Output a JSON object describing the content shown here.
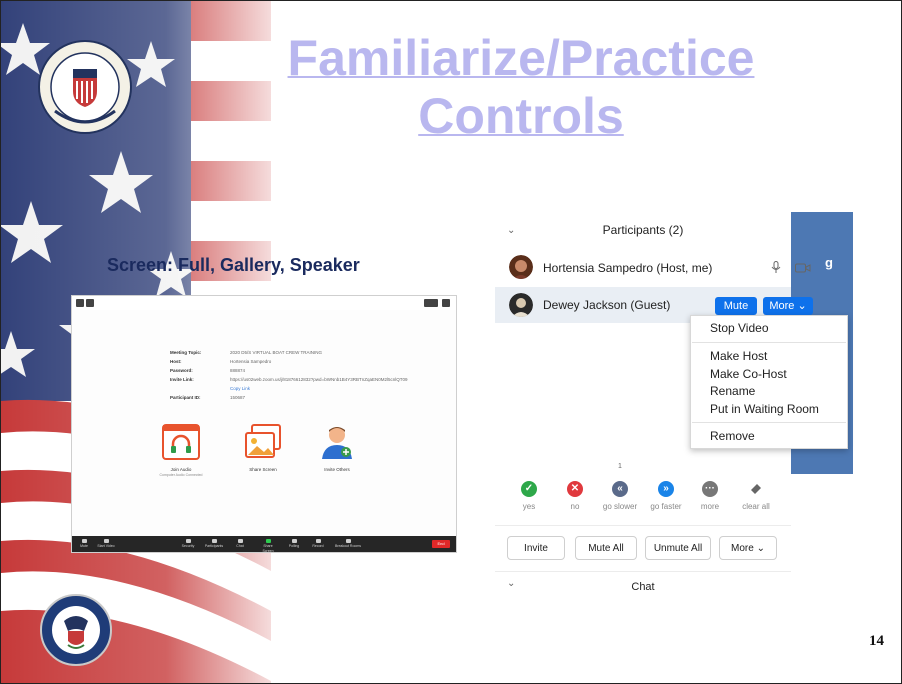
{
  "slide": {
    "title_line1": "Familiarize/Practice",
    "title_line2": "Controls",
    "caption": "Screen: Full, Gallery, Speaker",
    "page_number": "14"
  },
  "zoom_screen": {
    "info_rows": [
      {
        "key": "Meeting Topic:",
        "value": "2020 D5/S VIRTUAL BOAT CREW TRAINING"
      },
      {
        "key": "Host:",
        "value": "Hortensia Sampedro"
      },
      {
        "key": "Password:",
        "value": "888874"
      },
      {
        "key": "Invite Link:",
        "value": "https://us02web.zoom.us/j/81876612832?pwd=bWNnb1B4Y3RBTnZqaEN0M2l5cnlQT09"
      },
      {
        "key": "Participant ID:",
        "value": "150687"
      }
    ],
    "copy_link": "Copy Link",
    "tiles": {
      "join_audio": "Join Audio",
      "join_audio_sub": "Computer Audio Connected",
      "share_screen": "Share Screen",
      "invite_others": "Invite Others"
    },
    "controls": [
      "Mute",
      "Start Video",
      "Security",
      "Participants",
      "Chat",
      "Share Screen",
      "Polling",
      "Record",
      "Breakout Rooms"
    ],
    "end_label": "End"
  },
  "participants": {
    "header": "Participants (2)",
    "host_name": "Hortensia Sampedro (Host, me)",
    "guest_name": "Dewey Jackson (Guest)",
    "mute_label": "Mute",
    "more_label": "More",
    "strip_letter": "g",
    "menu": {
      "stop_video": "Stop Video",
      "make_host": "Make Host",
      "make_cohost": "Make Co-Host",
      "rename": "Rename",
      "waiting_room": "Put in Waiting Room",
      "remove": "Remove"
    },
    "reaction_count": "1",
    "reactions": {
      "yes": "yes",
      "no": "no",
      "slower": "go slower",
      "faster": "go faster",
      "more": "more",
      "clear": "clear all"
    },
    "actions": {
      "invite": "Invite",
      "mute_all": "Mute All",
      "unmute_all": "Unmute All",
      "more": "More"
    },
    "chat_label": "Chat"
  },
  "colors": {
    "title": "#b9b7ef",
    "zoom_blue": "#0e71eb",
    "caption": "#1a2a5e"
  }
}
